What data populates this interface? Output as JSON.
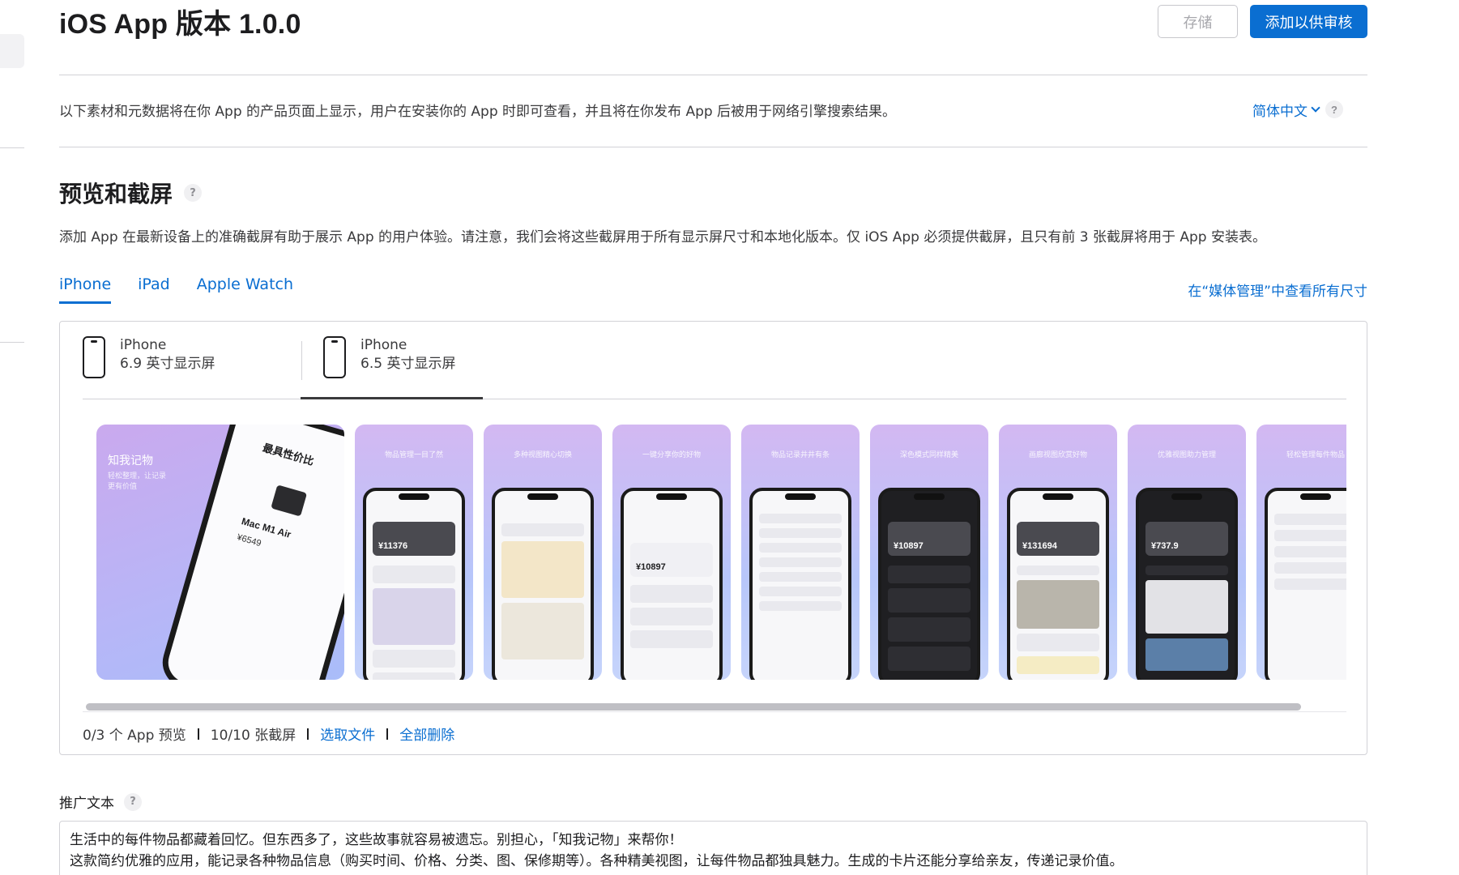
{
  "header": {
    "title": "iOS App 版本 1.0.0",
    "save_label": "存储",
    "submit_label": "添加以供审核"
  },
  "intro": {
    "text": "以下素材和元数据将在你 App 的产品页面上显示，用户在安装你的 App 时即可查看，并且将在你发布 App 后被用于网络引擎搜索结果。",
    "language": "简体中文",
    "help": "?"
  },
  "preview": {
    "title": "预览和截屏",
    "help": "?",
    "description": "添加 App 在最新设备上的准确截屏有助于展示 App 的用户体验。请注意，我们会将这些截屏用于所有显示屏尺寸和本地化版本。仅 iOS App 必须提供截屏，且只有前 3 张截屏将用于 App 安装表。",
    "tabs": [
      {
        "label": "iPhone",
        "active": true
      },
      {
        "label": "iPad",
        "active": false
      },
      {
        "label": "Apple Watch",
        "active": false
      }
    ],
    "media_link": "在“媒体管理”中查看所有尺寸",
    "devices": [
      {
        "name": "iPhone",
        "size": "6.9 英寸显示屏",
        "selected": false
      },
      {
        "name": "iPhone",
        "size": "6.5 英寸显示屏",
        "selected": true
      }
    ],
    "screenshots": [
      {
        "caption": "知我记物",
        "subcaption": "轻松整理，让记录更有价值",
        "phone_title": "最具性价比",
        "item_name": "Mac M1 Air",
        "item_price": "¥6549",
        "style": "wide"
      },
      {
        "caption": "物品管理一目了然",
        "card_value": "¥11376",
        "style": "light"
      },
      {
        "caption": "多种视图精心切换",
        "card_value": "",
        "style": "light-grid"
      },
      {
        "caption": "一键分享你的好物",
        "card_value": "¥10897",
        "style": "light"
      },
      {
        "caption": "物品记录井井有条",
        "card_value": "",
        "style": "list"
      },
      {
        "caption": "深色模式同样精美",
        "card_value": "¥10897",
        "style": "dark"
      },
      {
        "caption": "画廊视图欣赏好物",
        "card_value": "¥131694",
        "style": "light-gallery"
      },
      {
        "caption": "优雅视图助力管理",
        "card_value": "¥737.9",
        "style": "dark"
      },
      {
        "caption": "轻松管理每件物品",
        "card_value": "",
        "style": "list"
      }
    ],
    "stats": {
      "previews": "0/3 个 App 预览",
      "screenshots": "10/10 张截屏",
      "choose_file": "选取文件",
      "delete_all": "全部删除"
    }
  },
  "promo": {
    "label": "推广文本",
    "help": "?",
    "line1": "生活中的每件物品都藏着回忆。但东西多了，这些故事就容易被遗忘。别担心，「知我记物」来帮你！",
    "line2": "这款简约优雅的应用，能记录各种物品信息（购买时间、价格、分类、图、保修期等）。各种精美视图，让每件物品都独具魅力。生成的卡片还能分享给亲友，传递记录价值。"
  }
}
